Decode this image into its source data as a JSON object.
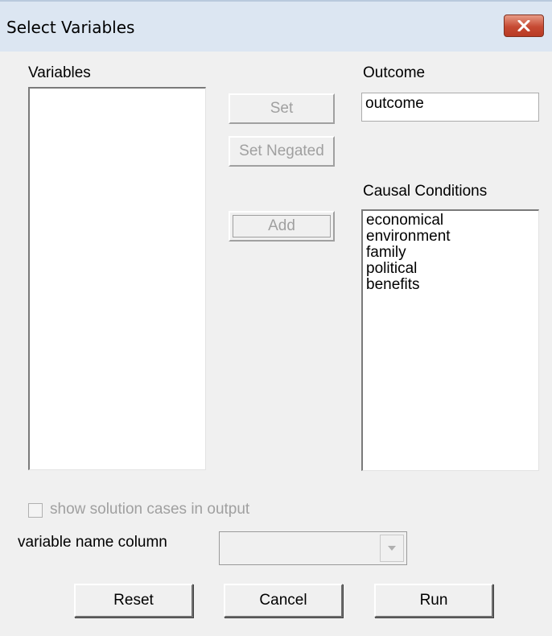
{
  "window": {
    "title": "Select Variables"
  },
  "variables": {
    "label": "Variables",
    "items": []
  },
  "outcome": {
    "label": "Outcome",
    "value": "outcome"
  },
  "buttons": {
    "set": "Set",
    "set_negated": "Set Negated",
    "add": "Add",
    "reset": "Reset",
    "cancel": "Cancel",
    "run": "Run"
  },
  "causal_conditions": {
    "label": "Causal Conditions",
    "items": [
      "economical",
      "environment",
      "family",
      "political",
      "benefits"
    ]
  },
  "options": {
    "show_solution_cases_label": "show solution cases in output",
    "show_solution_cases_checked": false,
    "variable_name_column_label": "variable name column",
    "variable_name_column_value": ""
  },
  "icons": {
    "close": "close-icon",
    "dropdown": "chevron-down-icon"
  }
}
